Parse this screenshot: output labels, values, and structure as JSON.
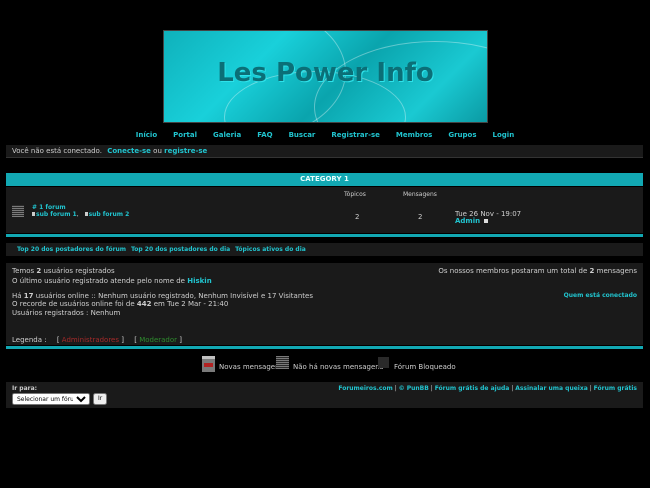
{
  "banner": {
    "title": "Les Power Info"
  },
  "nav": [
    "Início",
    "Portal",
    "Galeria",
    "FAQ",
    "Buscar",
    "Registrar-se",
    "Membros",
    "Grupos",
    "Login"
  ],
  "loginbar": {
    "text": "Você não está conectado.",
    "connect": "Conecte-se",
    "or": "ou",
    "register": "registre-se"
  },
  "category": {
    "title": "CATEGORY 1",
    "col_topics": "Tópicos",
    "col_posts": "Mensagens",
    "forum": {
      "name": "# 1 forum",
      "subforum1": "sub forum 1",
      "sep": ",",
      "subforum2": "sub forum 2",
      "topics": "2",
      "posts": "2",
      "last_date": "Tue 26 Nov - 19:07",
      "last_user": "Admin"
    }
  },
  "toplinks": [
    "Top 20 dos postadores do fórum",
    "Top 20 dos postadores do dia",
    "Tópicos ativos do dia"
  ],
  "stats": {
    "members_pre": "Temos",
    "members_count": "2",
    "members_post": "usuários registrados",
    "last_user_text": "O último usuário registrado atende pelo nome de",
    "last_user": "Hiskin",
    "total_posts_pre": "Os nossos membros postaram um total de",
    "total_posts": "2",
    "total_posts_post": "mensagens",
    "online_pre": "Há",
    "online_count": "17",
    "online_post": "usuários online :: Nenhum usuário registrado, Nenhum Invisível e 17 Visitantes",
    "record_pre": "O recorde de usuários online foi de",
    "record_count": "442",
    "record_post": "em Tue 2 Mar - 21:40",
    "registered": "Usuários registrados : Nenhum",
    "who_connected": "Quem está conectado",
    "legend_label": "Legenda :",
    "legend_admin": "Administradores",
    "legend_mod": "Moderador"
  },
  "legend": {
    "new": "Novas mensagens",
    "nonew": "Não há novas mensagens",
    "locked": "Fórum Bloqueado"
  },
  "footer": {
    "goto_label": "Ir para:",
    "select_value": "Selecionar um fórum",
    "go_button": "Ir",
    "links": [
      "Forumeiros.com",
      "© PunBB",
      "Fórum grátis de ajuda",
      "Assinalar uma queixa",
      "Fórum grátis"
    ]
  },
  "colors": {
    "accent": "#12a8b3",
    "link": "#21c4cf",
    "admin": "#a52a2a",
    "mod": "#2e8b2e"
  }
}
